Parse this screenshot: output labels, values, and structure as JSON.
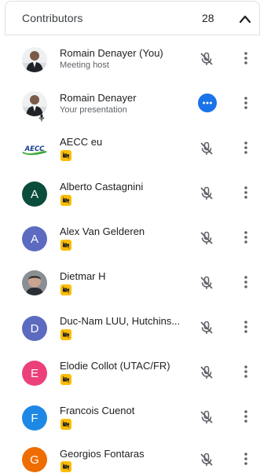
{
  "header": {
    "title": "Contributors",
    "count": "28",
    "chevron_icon": "chevron-up-icon"
  },
  "colors": {
    "presentation_button": "#1a73e8",
    "badge": "#fbbc04"
  },
  "participants": [
    {
      "name": "Romain Denayer (You)",
      "subtitle": "Meeting host",
      "avatar": "photo",
      "action": "mic-off"
    },
    {
      "name": "Romain Denayer",
      "subtitle": "Your presentation",
      "avatar": "photo-presenting",
      "action": "presentation-more"
    },
    {
      "name": "AECC eu",
      "avatar": "logo",
      "avatar_text": "AECC",
      "action": "mic-off"
    },
    {
      "name": "Alberto Castagnini",
      "avatar": "letter",
      "initial": "A",
      "color": "#0b4d3d",
      "action": "mic-off"
    },
    {
      "name": "Alex Van Gelderen",
      "avatar": "letter",
      "initial": "A",
      "color": "#5c6bc0",
      "action": "mic-off"
    },
    {
      "name": "Dietmar H",
      "avatar": "photo",
      "action": "mic-off"
    },
    {
      "name": "Duc-Nam LUU, Hutchins...",
      "avatar": "letter",
      "initial": "D",
      "color": "#5c6bc0",
      "action": "mic-off"
    },
    {
      "name": "Elodie Collot (UTAC/FR)",
      "avatar": "letter",
      "initial": "E",
      "color": "#ec407a",
      "action": "mic-off"
    },
    {
      "name": "Francois Cuenot",
      "avatar": "letter",
      "initial": "F",
      "color": "#1e88e5",
      "action": "mic-off"
    },
    {
      "name": "Georgios Fontaras",
      "avatar": "letter",
      "initial": "G",
      "color": "#ef6c00",
      "action": "mic-off"
    }
  ]
}
